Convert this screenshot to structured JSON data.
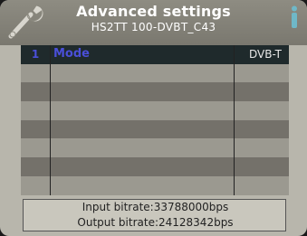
{
  "header": {
    "title": "Advanced settings",
    "subtitle": "HS2TT  100-DVBT_C43",
    "left_icon": "wrench-icon",
    "right_icon": "info-icon"
  },
  "table": {
    "rows": [
      {
        "index": "1",
        "label": "Mode",
        "value": "DVB-T",
        "selected": true
      },
      {
        "index": "",
        "label": "",
        "value": ""
      },
      {
        "index": "",
        "label": "",
        "value": ""
      },
      {
        "index": "",
        "label": "",
        "value": ""
      },
      {
        "index": "",
        "label": "",
        "value": ""
      },
      {
        "index": "",
        "label": "",
        "value": ""
      },
      {
        "index": "",
        "label": "",
        "value": ""
      },
      {
        "index": "",
        "label": "",
        "value": ""
      }
    ]
  },
  "footer": {
    "input_bitrate": "Input bitrate:33788000bps",
    "output_bitrate": "Output bitrate:24128342bps"
  },
  "colors": {
    "accent": "#4a4fd8",
    "selected_row": "#1f2a2c"
  }
}
